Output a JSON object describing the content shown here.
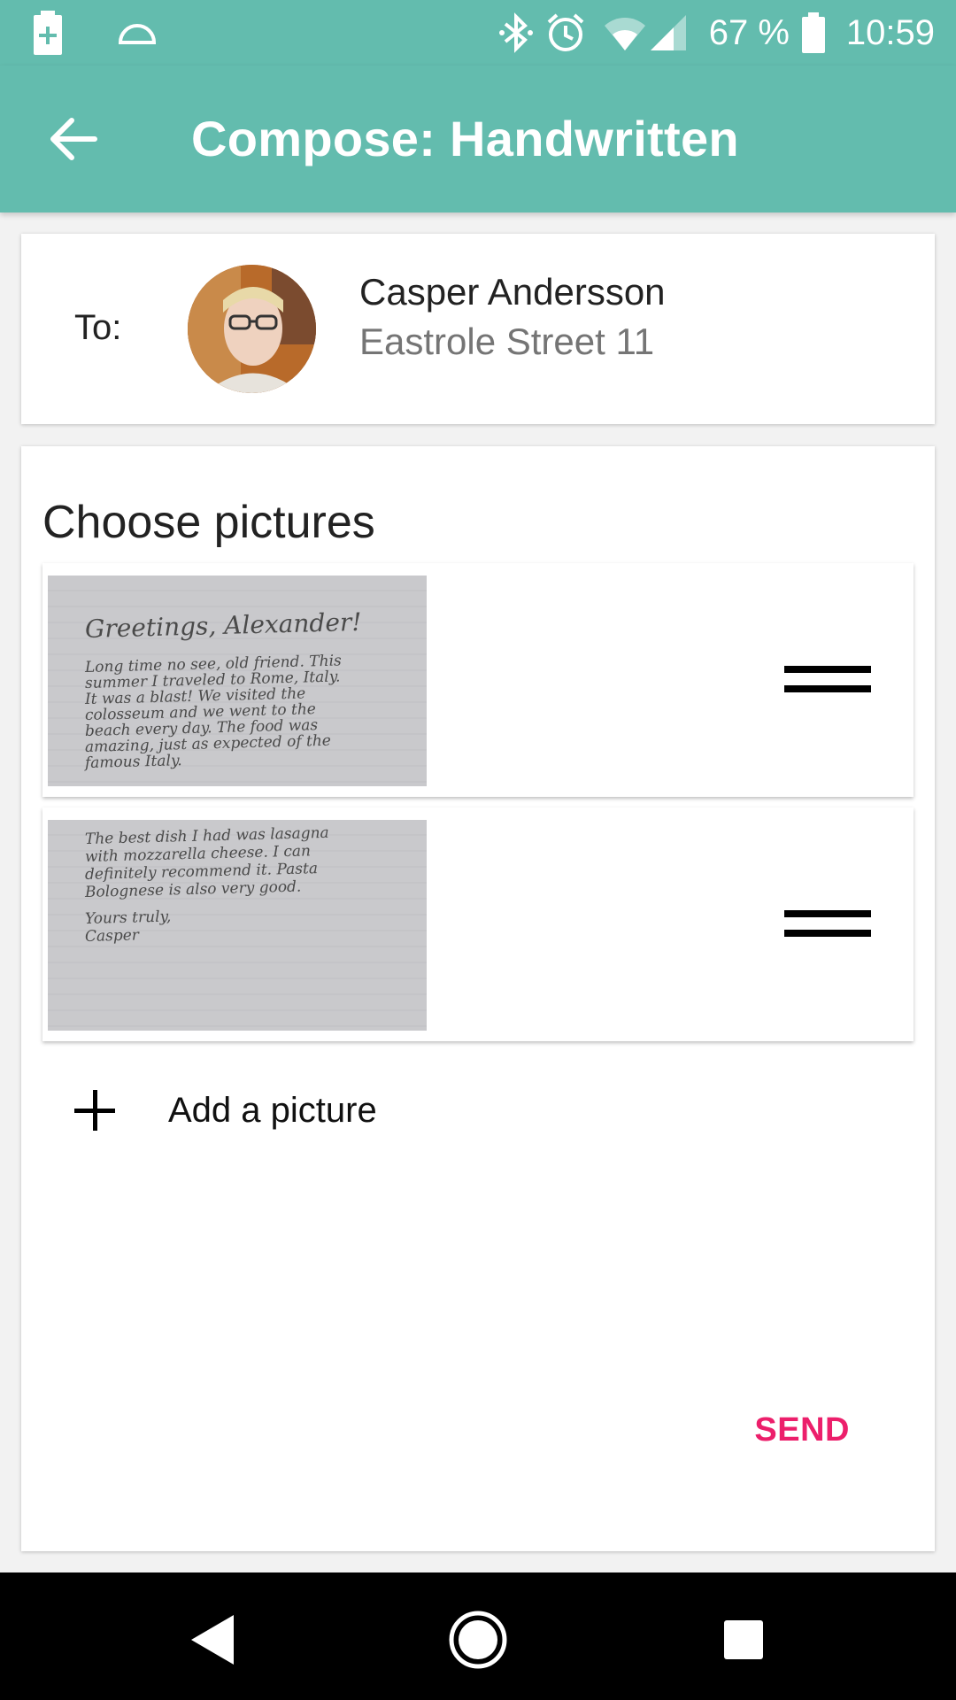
{
  "status_bar": {
    "battery_percent": "67 %",
    "time": "10:59",
    "icons": [
      "battery-charging-icon",
      "sleep-icon",
      "bluetooth-icon",
      "alarm-icon",
      "wifi-icon",
      "cell-signal-icon",
      "battery-icon"
    ]
  },
  "app_bar": {
    "title": "Compose: Handwritten",
    "back_icon": "arrow-back-icon"
  },
  "recipient": {
    "to_label": "To:",
    "name": "Casper Andersson",
    "address": "Eastrole Street 11"
  },
  "pictures": {
    "section_title": "Choose pictures",
    "items": [
      {
        "lines": [
          "Greetings, Alexander!",
          "Long time no see, old friend. This",
          "summer I traveled to Rome, Italy.",
          "It was a blast! We visited the",
          "colosseum and we went to the",
          "beach every day. The food was",
          "amazing, just as expected of the",
          "famous Italy."
        ]
      },
      {
        "lines": [
          "The best dish I had was lasagna",
          "with mozzarella cheese. I can",
          "definitely recommend it. Pasta",
          "Bolognese is also very good.",
          "Yours truly,",
          "Casper"
        ]
      }
    ],
    "add_label": "Add a picture",
    "send_label": "SEND"
  },
  "colors": {
    "primary": "#63bcae",
    "accent": "#ec1f6b"
  }
}
